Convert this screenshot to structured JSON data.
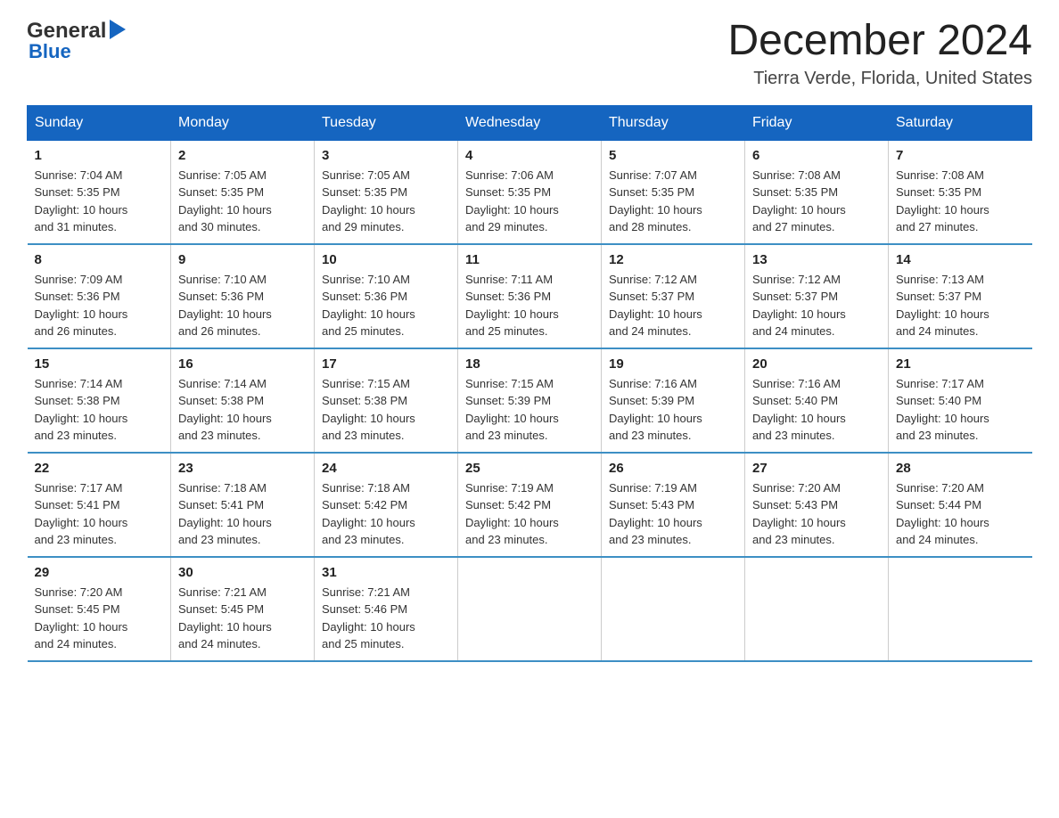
{
  "logo": {
    "general": "General",
    "blue": "Blue"
  },
  "title": "December 2024",
  "location": "Tierra Verde, Florida, United States",
  "headers": [
    "Sunday",
    "Monday",
    "Tuesday",
    "Wednesday",
    "Thursday",
    "Friday",
    "Saturday"
  ],
  "weeks": [
    [
      {
        "day": "1",
        "sunrise": "7:04 AM",
        "sunset": "5:35 PM",
        "daylight": "10 hours and 31 minutes."
      },
      {
        "day": "2",
        "sunrise": "7:05 AM",
        "sunset": "5:35 PM",
        "daylight": "10 hours and 30 minutes."
      },
      {
        "day": "3",
        "sunrise": "7:05 AM",
        "sunset": "5:35 PM",
        "daylight": "10 hours and 29 minutes."
      },
      {
        "day": "4",
        "sunrise": "7:06 AM",
        "sunset": "5:35 PM",
        "daylight": "10 hours and 29 minutes."
      },
      {
        "day": "5",
        "sunrise": "7:07 AM",
        "sunset": "5:35 PM",
        "daylight": "10 hours and 28 minutes."
      },
      {
        "day": "6",
        "sunrise": "7:08 AM",
        "sunset": "5:35 PM",
        "daylight": "10 hours and 27 minutes."
      },
      {
        "day": "7",
        "sunrise": "7:08 AM",
        "sunset": "5:35 PM",
        "daylight": "10 hours and 27 minutes."
      }
    ],
    [
      {
        "day": "8",
        "sunrise": "7:09 AM",
        "sunset": "5:36 PM",
        "daylight": "10 hours and 26 minutes."
      },
      {
        "day": "9",
        "sunrise": "7:10 AM",
        "sunset": "5:36 PM",
        "daylight": "10 hours and 26 minutes."
      },
      {
        "day": "10",
        "sunrise": "7:10 AM",
        "sunset": "5:36 PM",
        "daylight": "10 hours and 25 minutes."
      },
      {
        "day": "11",
        "sunrise": "7:11 AM",
        "sunset": "5:36 PM",
        "daylight": "10 hours and 25 minutes."
      },
      {
        "day": "12",
        "sunrise": "7:12 AM",
        "sunset": "5:37 PM",
        "daylight": "10 hours and 24 minutes."
      },
      {
        "day": "13",
        "sunrise": "7:12 AM",
        "sunset": "5:37 PM",
        "daylight": "10 hours and 24 minutes."
      },
      {
        "day": "14",
        "sunrise": "7:13 AM",
        "sunset": "5:37 PM",
        "daylight": "10 hours and 24 minutes."
      }
    ],
    [
      {
        "day": "15",
        "sunrise": "7:14 AM",
        "sunset": "5:38 PM",
        "daylight": "10 hours and 23 minutes."
      },
      {
        "day": "16",
        "sunrise": "7:14 AM",
        "sunset": "5:38 PM",
        "daylight": "10 hours and 23 minutes."
      },
      {
        "day": "17",
        "sunrise": "7:15 AM",
        "sunset": "5:38 PM",
        "daylight": "10 hours and 23 minutes."
      },
      {
        "day": "18",
        "sunrise": "7:15 AM",
        "sunset": "5:39 PM",
        "daylight": "10 hours and 23 minutes."
      },
      {
        "day": "19",
        "sunrise": "7:16 AM",
        "sunset": "5:39 PM",
        "daylight": "10 hours and 23 minutes."
      },
      {
        "day": "20",
        "sunrise": "7:16 AM",
        "sunset": "5:40 PM",
        "daylight": "10 hours and 23 minutes."
      },
      {
        "day": "21",
        "sunrise": "7:17 AM",
        "sunset": "5:40 PM",
        "daylight": "10 hours and 23 minutes."
      }
    ],
    [
      {
        "day": "22",
        "sunrise": "7:17 AM",
        "sunset": "5:41 PM",
        "daylight": "10 hours and 23 minutes."
      },
      {
        "day": "23",
        "sunrise": "7:18 AM",
        "sunset": "5:41 PM",
        "daylight": "10 hours and 23 minutes."
      },
      {
        "day": "24",
        "sunrise": "7:18 AM",
        "sunset": "5:42 PM",
        "daylight": "10 hours and 23 minutes."
      },
      {
        "day": "25",
        "sunrise": "7:19 AM",
        "sunset": "5:42 PM",
        "daylight": "10 hours and 23 minutes."
      },
      {
        "day": "26",
        "sunrise": "7:19 AM",
        "sunset": "5:43 PM",
        "daylight": "10 hours and 23 minutes."
      },
      {
        "day": "27",
        "sunrise": "7:20 AM",
        "sunset": "5:43 PM",
        "daylight": "10 hours and 23 minutes."
      },
      {
        "day": "28",
        "sunrise": "7:20 AM",
        "sunset": "5:44 PM",
        "daylight": "10 hours and 24 minutes."
      }
    ],
    [
      {
        "day": "29",
        "sunrise": "7:20 AM",
        "sunset": "5:45 PM",
        "daylight": "10 hours and 24 minutes."
      },
      {
        "day": "30",
        "sunrise": "7:21 AM",
        "sunset": "5:45 PM",
        "daylight": "10 hours and 24 minutes."
      },
      {
        "day": "31",
        "sunrise": "7:21 AM",
        "sunset": "5:46 PM",
        "daylight": "10 hours and 25 minutes."
      },
      null,
      null,
      null,
      null
    ]
  ],
  "labels": {
    "sunrise": "Sunrise:",
    "sunset": "Sunset:",
    "daylight": "Daylight:"
  }
}
